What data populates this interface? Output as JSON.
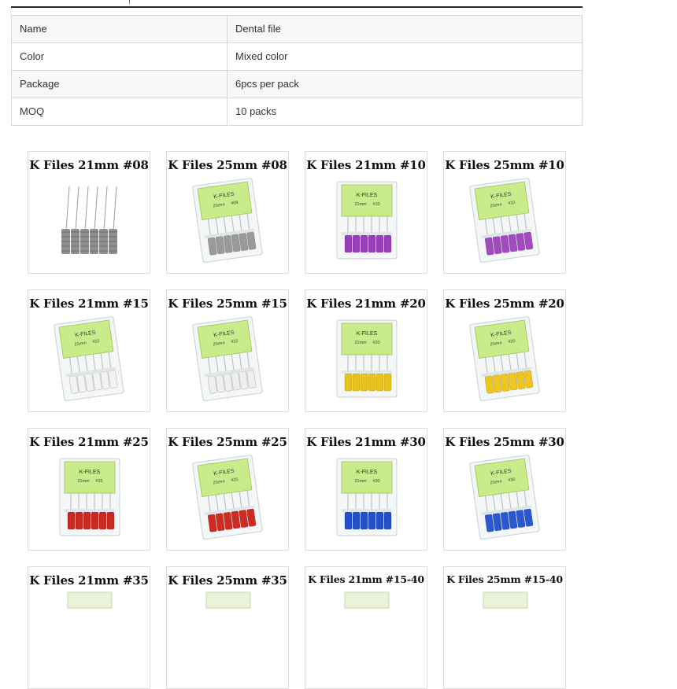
{
  "spec_table": [
    {
      "key": "Name",
      "value": "Dental file"
    },
    {
      "key": "Color",
      "value": "Mixed color"
    },
    {
      "key": "Package",
      "value": "6pcs per pack"
    },
    {
      "key": "MOQ",
      "value": "10 packs"
    }
  ],
  "products": [
    {
      "title": "K Files 21mm #08",
      "style": "loose",
      "handle_color": "#8f8f8f"
    },
    {
      "title": "K Files 25mm #08",
      "style": "pack-tilt",
      "handle_color": "#9a9a9a",
      "pack_label": "K-FILES",
      "pack_size": "25mm",
      "pack_num": "#08"
    },
    {
      "title": "K Files 21mm #10",
      "style": "pack-straight",
      "handle_color": "#9b3fb8",
      "pack_label": "K-FILES",
      "pack_size": "21mm",
      "pack_num": "#10"
    },
    {
      "title": "K Files 25mm #10",
      "style": "pack-tilt",
      "handle_color": "#a24bc0",
      "pack_label": "K-FILES",
      "pack_size": "25mm",
      "pack_num": "#10"
    },
    {
      "title": "K Files 21mm #15",
      "style": "pack-tilt",
      "handle_color": "#f2f2f2",
      "pack_label": "K-FILES",
      "pack_size": "21mm",
      "pack_num": "#15"
    },
    {
      "title": "K Files 25mm #15",
      "style": "pack-tilt",
      "handle_color": "#eeeeee",
      "pack_label": "K-FILES",
      "pack_size": "25mm",
      "pack_num": "#15"
    },
    {
      "title": "K Files 21mm #20",
      "style": "pack-straight",
      "handle_color": "#e8c21c",
      "pack_label": "K-FILES",
      "pack_size": "21mm",
      "pack_num": "#20"
    },
    {
      "title": "K Files 25mm #20",
      "style": "pack-tilt",
      "handle_color": "#efc61e",
      "pack_label": "K-FILES",
      "pack_size": "25mm",
      "pack_num": "#20"
    },
    {
      "title": "K Files 21mm #25",
      "style": "pack-straight",
      "handle_color": "#c92a1f",
      "pack_label": "K-FILES",
      "pack_size": "21mm",
      "pack_num": "#25"
    },
    {
      "title": "K Files 25mm #25",
      "style": "pack-tilt",
      "handle_color": "#d02b22",
      "pack_label": "K-FILES",
      "pack_size": "25mm",
      "pack_num": "#25"
    },
    {
      "title": "K Files 21mm #30",
      "style": "pack-straight",
      "handle_color": "#2350c8",
      "pack_label": "K-FILES",
      "pack_size": "21mm",
      "pack_num": "#30"
    },
    {
      "title": "K Files 25mm #30",
      "style": "pack-tilt",
      "handle_color": "#2a58d0",
      "pack_label": "K-FILES",
      "pack_size": "25mm",
      "pack_num": "#30"
    },
    {
      "title": "K Files 21mm #35",
      "style": "partial",
      "handle_color": "#2e9a3c"
    },
    {
      "title": "K Files 25mm #35",
      "style": "partial",
      "handle_color": "#2e9a3c"
    },
    {
      "title": "K Files 21mm #15-40",
      "style": "partial",
      "handle_color": "#888888"
    },
    {
      "title": "K Files 25mm #15-40",
      "style": "partial",
      "handle_color": "#888888"
    }
  ]
}
